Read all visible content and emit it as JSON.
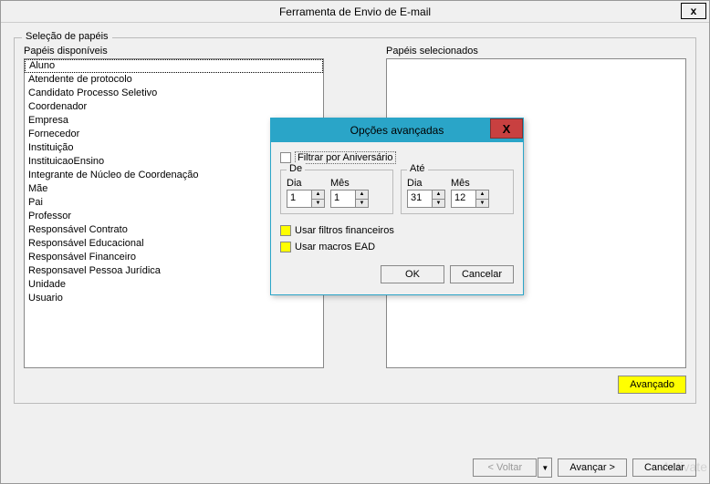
{
  "window": {
    "title": "Ferramenta de Envio de E-mail",
    "close_glyph": "x"
  },
  "roles_section": {
    "legend": "Seleção de papéis",
    "available_label": "Papéis disponíveis",
    "selected_label": "Papéis selecionados",
    "available": [
      "Aluno",
      "Atendente de protocolo",
      "Candidato Processo Seletivo",
      "Coordenador",
      "Empresa",
      "Fornecedor",
      "Instituição",
      "InstituicaoEnsino",
      "Integrante de Núcleo de Coordenação",
      "Mãe",
      "Pai",
      "Professor",
      "Responsável Contrato",
      "Responsável Educacional",
      "Responsável Financeiro",
      "Responsavel Pessoa Jurídica",
      "Unidade",
      "Usuario"
    ],
    "selected": []
  },
  "buttons": {
    "advanced": "Avançado",
    "back": "< Voltar",
    "next": "Avançar >",
    "cancel": "Cancelar"
  },
  "dialog": {
    "title": "Opções avançadas",
    "close_glyph": "X",
    "filter_birthday": "Filtrar por Aniversário",
    "from_legend": "De",
    "to_legend": "Até",
    "day_label": "Dia",
    "month_label": "Mês",
    "from_day": "1",
    "from_month": "1",
    "to_day": "31",
    "to_month": "12",
    "use_financial": "Usar filtros financeiros",
    "use_macros": "Usar macros EAD",
    "ok": "OK",
    "cancel": "Cancelar"
  },
  "watermark": "Activate"
}
